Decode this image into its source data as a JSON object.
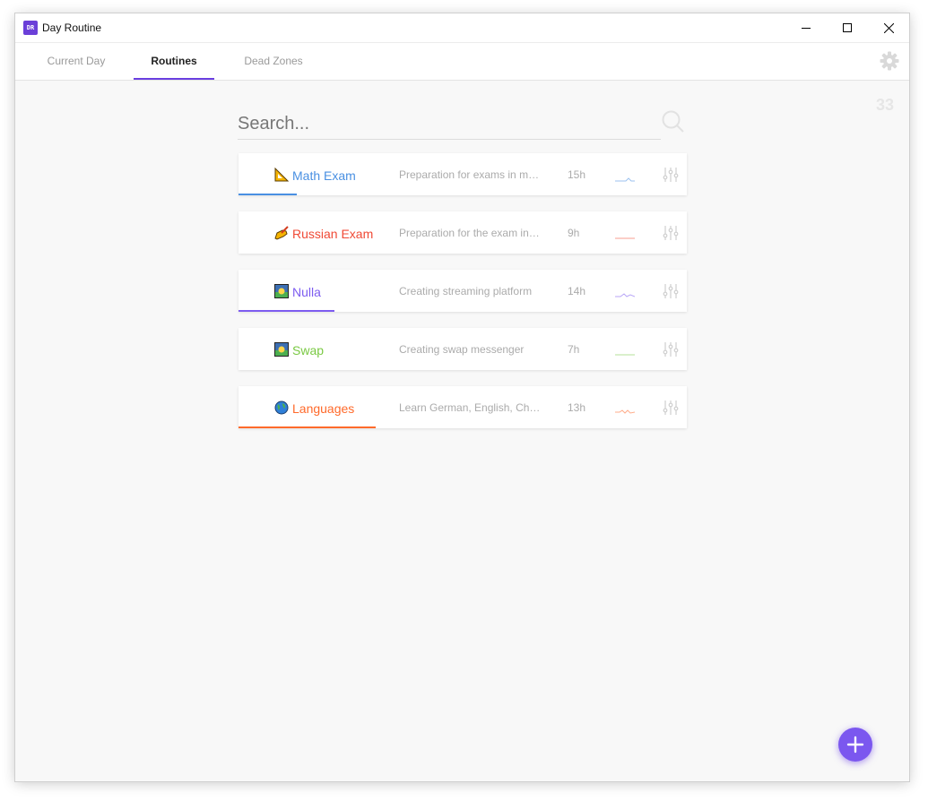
{
  "window": {
    "title": "Day Routine",
    "app_icon_text": "DR"
  },
  "tabs": [
    {
      "label": "Current Day",
      "active": false
    },
    {
      "label": "Routines",
      "active": true
    },
    {
      "label": "Dead Zones",
      "active": false
    }
  ],
  "counter": "33",
  "search": {
    "placeholder": "Search...",
    "value": ""
  },
  "routines": [
    {
      "icon": "triangular-ruler-icon",
      "name": "Math Exam",
      "description": "Preparation for exams in math and physics",
      "hours": "15h",
      "color": "#4a90e2",
      "progress": 0.13
    },
    {
      "icon": "writing-hand-icon",
      "name": "Russian Exam",
      "description": "Preparation for the exam in Russian",
      "hours": "9h",
      "color": "#f04a36",
      "progress": 0
    },
    {
      "icon": "sunrise-icon",
      "name": "Nulla",
      "description": "Creating streaming platform",
      "hours": "14h",
      "color": "#7d5cf0",
      "progress": 0.214
    },
    {
      "icon": "sunrise-icon",
      "name": "Swap",
      "description": "Creating swap messenger",
      "hours": "7h",
      "color": "#7ac943",
      "progress": 0
    },
    {
      "icon": "globe-icon",
      "name": "Languages",
      "description": "Learn German, English, Chinese",
      "hours": "13h",
      "color": "#ff6a2b",
      "progress": 0.305
    }
  ],
  "fab": {
    "color": "#7b57ef"
  },
  "accent_color": "#6a3fe0"
}
